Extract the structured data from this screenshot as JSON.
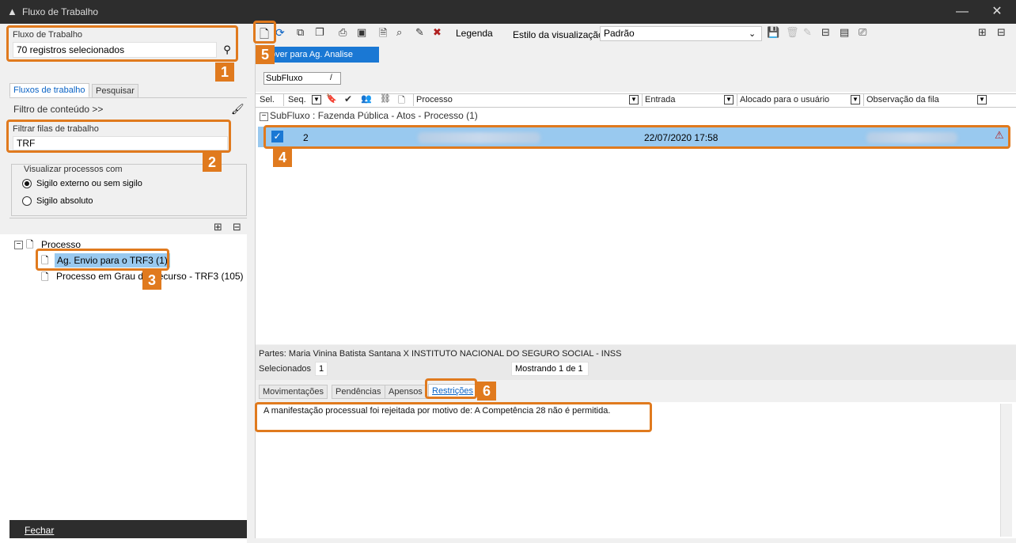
{
  "window": {
    "title": "Fluxo de Trabalho"
  },
  "left": {
    "workflow_label": "Fluxo de Trabalho",
    "workflow_value": "70 registros selecionados",
    "tabs": [
      {
        "label": "Fluxos de trabalho"
      },
      {
        "label": "Pesquisar"
      }
    ],
    "content_filter": "Filtro de conteúdo >>",
    "queue_filter_label": "Filtrar filas de trabalho",
    "queue_filter_value": "TRF",
    "visibility_group": "Visualizar processos com",
    "radio_options": [
      {
        "label": "Sigilo externo ou sem sigilo",
        "selected": true
      },
      {
        "label": "Sigilo absoluto",
        "selected": false
      }
    ],
    "tree": {
      "root": "Processo",
      "children": [
        {
          "label": "Ag. Envio  para o TRF3 (1)",
          "selected": true
        },
        {
          "label": "Processo em Grau de Recurso - TRF3 (105)",
          "selected": false
        }
      ]
    },
    "close_button": "Fechar"
  },
  "toolbar": {
    "legend_label": "Legenda",
    "view_style_label": "Estilo da visualização",
    "view_style_value": "Padrão",
    "action_banner": "over para Ag. Analise"
  },
  "grid": {
    "group_by": "SubFluxo",
    "group_sort": "/",
    "columns": {
      "sel": "Sel.",
      "seq": "Seq.",
      "processo": "Processo",
      "entrada": "Entrada",
      "alocado": "Alocado para o usuário",
      "observacao": "Observação da fila"
    },
    "group_row": "SubFluxo : Fazenda Pública - Atos - Processo  (1)",
    "rows": [
      {
        "seq": "2",
        "entrada": "22/07/2020 17:58",
        "checked": true
      }
    ]
  },
  "details": {
    "partes": "Partes: Maria Vinina Batista Santana  X  INSTITUTO NACIONAL DO SEGURO SOCIAL - INSS",
    "selected_label": "Selecionados",
    "selected_count": "1",
    "showing": "Mostrando 1 de 1",
    "tabs": [
      {
        "label": "Movimentações"
      },
      {
        "label": "Pendências"
      },
      {
        "label": "Apensos"
      },
      {
        "label": "Restrições"
      }
    ],
    "restriction_text": "A manifestação processual foi rejeitada por motivo de: A Competência 28 não é permitida."
  },
  "callouts": [
    "1",
    "2",
    "3",
    "4",
    "5",
    "6"
  ],
  "colors": {
    "highlight": "#e07a1e",
    "selection": "#99c9ef",
    "link": "#0a63c5",
    "banner": "#1a78d4"
  }
}
